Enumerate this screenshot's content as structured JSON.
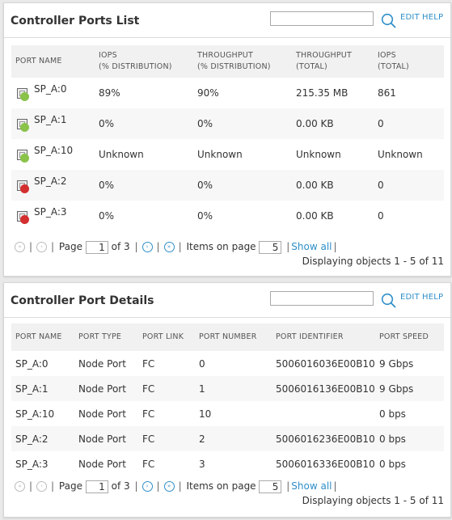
{
  "ports_list": {
    "title": "Controller Ports List",
    "search_placeholder": "",
    "edit_label": "EDIT",
    "help_label": "HELP",
    "columns": [
      {
        "line1": "PORT NAME",
        "line2": ""
      },
      {
        "line1": "IOPS",
        "line2": "(% DISTRIBUTION)"
      },
      {
        "line1": "THROUGHPUT",
        "line2": "(% DISTRIBUTION)"
      },
      {
        "line1": "THROUGHPUT",
        "line2": "(TOTAL)"
      },
      {
        "line1": "IOPS",
        "line2": "(TOTAL)"
      }
    ],
    "rows": [
      {
        "port": "SP_A:0",
        "status": "green",
        "iops_dist": "89%",
        "throughput_dist": "90%",
        "throughput_total": "215.35 MB",
        "iops_total": "861"
      },
      {
        "port": "SP_A:1",
        "status": "green",
        "iops_dist": "0%",
        "throughput_dist": "0%",
        "throughput_total": "0.00 KB",
        "iops_total": "0"
      },
      {
        "port": "SP_A:10",
        "status": "green",
        "iops_dist": "Unknown",
        "throughput_dist": "Unknown",
        "throughput_total": "Unknown",
        "iops_total": "Unknown"
      },
      {
        "port": "SP_A:2",
        "status": "red",
        "iops_dist": "0%",
        "throughput_dist": "0%",
        "throughput_total": "0.00 KB",
        "iops_total": "0"
      },
      {
        "port": "SP_A:3",
        "status": "red",
        "iops_dist": "0%",
        "throughput_dist": "0%",
        "throughput_total": "0.00 KB",
        "iops_total": "0"
      }
    ],
    "pager": {
      "page_label": "Page",
      "page_value": "1",
      "of_label": "of 3",
      "items_label": "Items on page",
      "items_value": "5",
      "show_all": "Show all",
      "displaying": "Displaying objects 1 - 5 of 11"
    }
  },
  "port_details": {
    "title": "Controller Port Details",
    "search_placeholder": "",
    "edit_label": "EDIT",
    "help_label": "HELP",
    "columns": [
      "PORT NAME",
      "PORT TYPE",
      "PORT LINK",
      "PORT NUMBER",
      "PORT IDENTIFIER",
      "PORT SPEED"
    ],
    "rows": [
      {
        "name": "SP_A:0",
        "type": "Node Port",
        "link": "FC",
        "number": "0",
        "identifier": "5006016036E00B10",
        "speed": "9 Gbps"
      },
      {
        "name": "SP_A:1",
        "type": "Node Port",
        "link": "FC",
        "number": "1",
        "identifier": "5006016136E00B10",
        "speed": "9 Gbps"
      },
      {
        "name": "SP_A:10",
        "type": "Node Port",
        "link": "FC",
        "number": "10",
        "identifier": "",
        "speed": "0 bps"
      },
      {
        "name": "SP_A:2",
        "type": "Node Port",
        "link": "FC",
        "number": "2",
        "identifier": "5006016236E00B10",
        "speed": "0 bps"
      },
      {
        "name": "SP_A:3",
        "type": "Node Port",
        "link": "FC",
        "number": "3",
        "identifier": "5006016336E00B10",
        "speed": "0 bps"
      }
    ],
    "pager": {
      "page_label": "Page",
      "page_value": "1",
      "of_label": "of 3",
      "items_label": "Items on page",
      "items_value": "5",
      "show_all": "Show all",
      "displaying": "Displaying objects 1 - 5 of 11"
    }
  },
  "icons": {
    "first_page": "first-page-icon",
    "prev_page": "prev-page-icon",
    "next_page": "next-page-icon",
    "last_page": "last-page-icon",
    "search": "search-icon",
    "port": "port-icon"
  },
  "colors": {
    "link": "#2f8fc9",
    "status_green": "#8bc34a",
    "status_red": "#d32f2f"
  }
}
